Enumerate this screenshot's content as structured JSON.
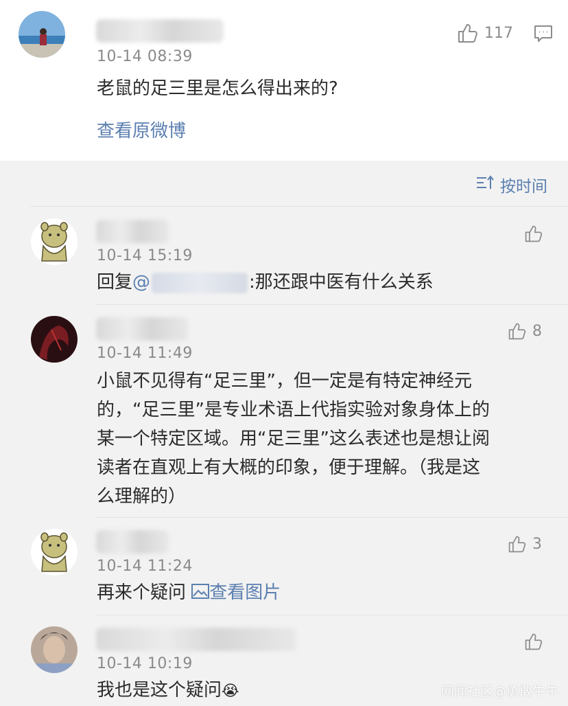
{
  "post": {
    "time": "10-14 08:39",
    "like_count": "117",
    "content": "老鼠的足三里是怎么得出来的?",
    "view_original_label": "查看原微博"
  },
  "sort": {
    "label": "按时间"
  },
  "comments": [
    {
      "time": "10-14 15:19",
      "reply_prefix": "回复",
      "mention_at": "@",
      "text_after_mention": ":那还跟中医有什么关系",
      "like_count": ""
    },
    {
      "time": "10-14 11:49",
      "text": "小鼠不见得有“足三里”，但一定是有特定神经元的，“足三里”是专业术语上代指实验对象身体上的某一个特定区域。用“足三里”这么表述也是想让阅读者在直观上有大概的印象，便于理解。（我是这么理解的）",
      "lines": [
        "小鼠不见得有“足三里”，但一定是有特定神经元",
        "的，“足三里”是专业术语上代指实验对象身体上的",
        "某一个特定区域。用“足三里”这么表述也是想让阅",
        "读者在直观上有大概的印象，便于理解。（我是这",
        "么理解的）"
      ],
      "like_count": "8"
    },
    {
      "time": "10-14 11:24",
      "text": "再来个疑问",
      "image_link_label": "查看图片",
      "like_count": "3"
    },
    {
      "time": "10-14 10:19",
      "text": "我也是这个疑问",
      "emoji": "😭",
      "like_count": ""
    }
  ],
  "watermark": "网闻社区@勇敢牛牛",
  "colors": {
    "link": "#5b7fb0",
    "background": "#f2f2f2",
    "text": "#2b2b2b",
    "meta": "#8a8a8a"
  }
}
